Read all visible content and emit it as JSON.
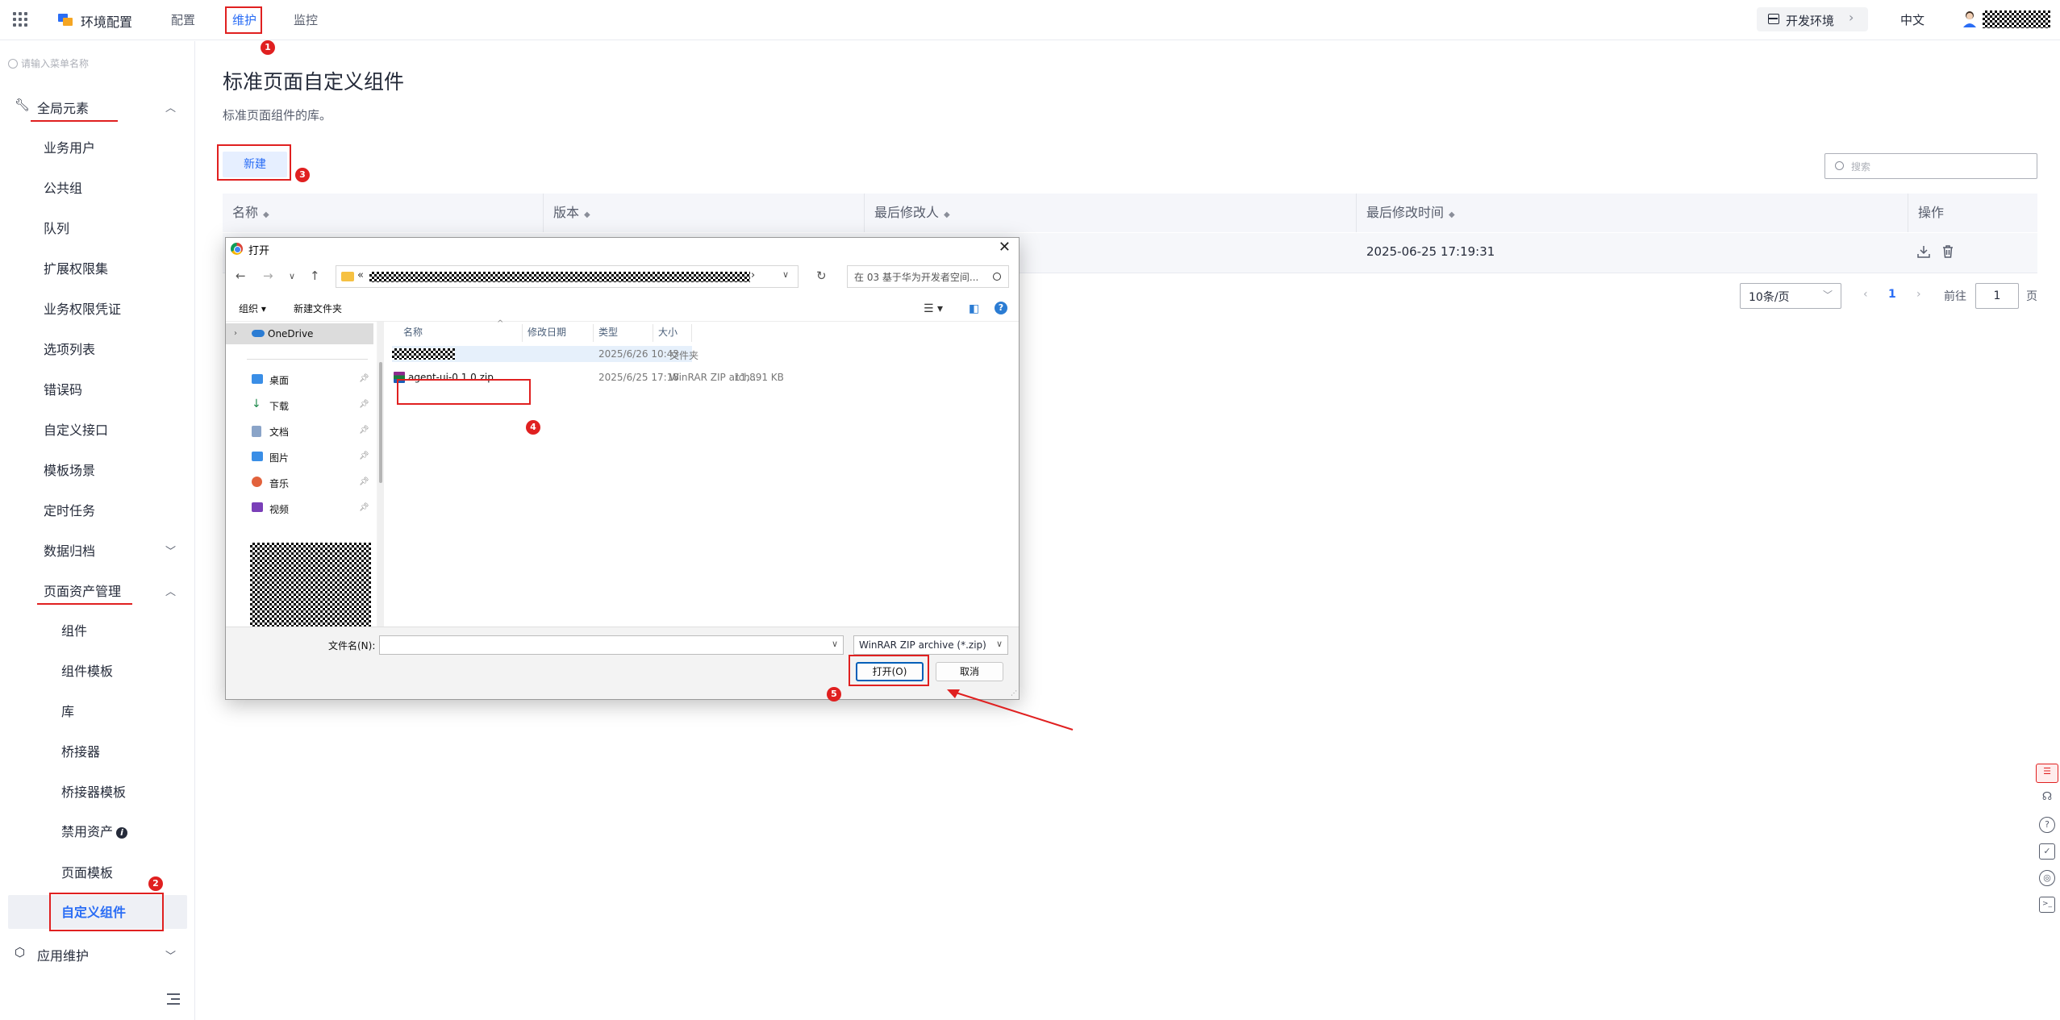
{
  "topbar": {
    "app_name": "环境配置",
    "nav": [
      "配置",
      "维护",
      "监控"
    ],
    "env_label": "开发环境",
    "language": "中文"
  },
  "sidebar": {
    "search_placeholder": "请输入菜单名称",
    "group_global": "全局元素",
    "items": [
      "业务用户",
      "公共组",
      "队列",
      "扩展权限集",
      "业务权限凭证",
      "选项列表",
      "错误码",
      "自定义接口",
      "模板场景",
      "定时任务",
      "数据归档",
      "页面资产管理"
    ],
    "sub_items": [
      "组件",
      "组件模板",
      "库",
      "桥接器",
      "桥接器模板",
      "禁用资产",
      "页面模板",
      "自定义组件"
    ],
    "group_app": "应用维护"
  },
  "main": {
    "title": "标准页面自定义组件",
    "description": "标准页面组件的库。",
    "new_button": "新建",
    "search_placeholder": "搜索",
    "columns": [
      "名称",
      "版本",
      "最后修改人",
      "最后修改时间",
      "操作"
    ],
    "row_time": "2025-06-25 17:19:31",
    "page_size": "10条/页",
    "current_page": "1",
    "goto_label": "前往",
    "goto_value": "1",
    "page_unit": "页"
  },
  "dialog": {
    "title": "打开",
    "address_prefix": "«",
    "search_placeholder": "在 03 基于华为开发者空间...",
    "organize": "组织 ▾",
    "new_folder": "新建文件夹",
    "nav_items": [
      "OneDrive",
      "桌面",
      "下载",
      "文档",
      "图片",
      "音乐",
      "视频"
    ],
    "file_columns": [
      "名称",
      "修改日期",
      "类型",
      "大小"
    ],
    "files": [
      {
        "name": "",
        "date": "2025/6/26 10:43",
        "type": "文件夹",
        "size": ""
      },
      {
        "name": "agent-ui-0.1.0.zip",
        "date": "2025/6/25 17:18",
        "type": "WinRAR ZIP arch...",
        "size": "11,891 KB"
      }
    ],
    "filename_label": "文件名(N):",
    "filename_value": "",
    "filetype": "WinRAR ZIP archive (*.zip)",
    "open_button": "打开(O)",
    "cancel_button": "取消"
  },
  "annotations": [
    "1",
    "2",
    "3",
    "4",
    "5"
  ],
  "colors": {
    "accent": "#2a6df5",
    "annotation": "#e02020"
  }
}
